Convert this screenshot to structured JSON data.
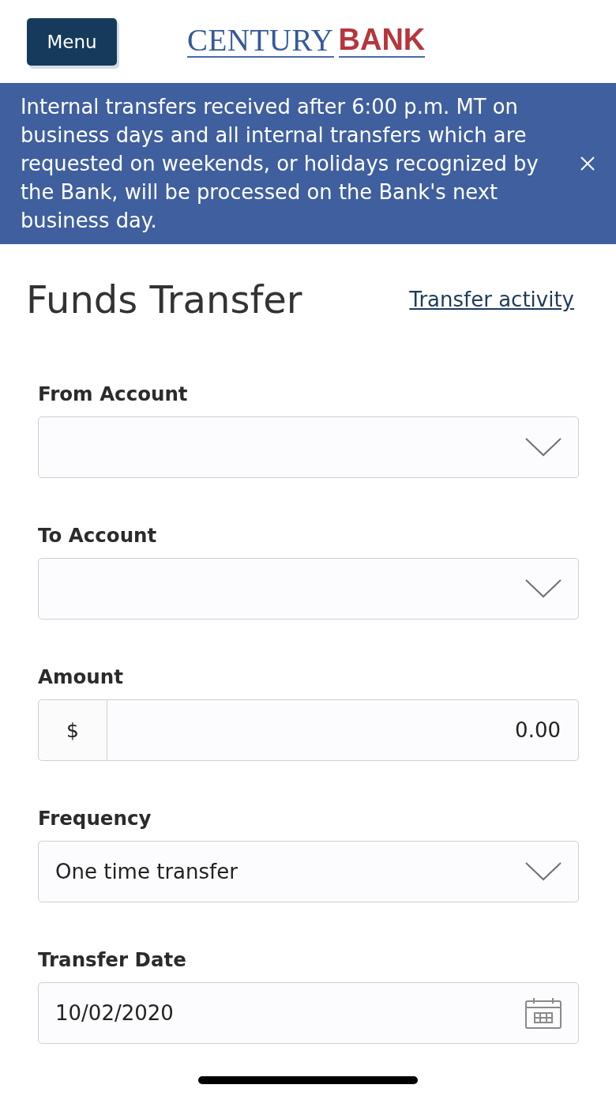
{
  "header": {
    "menu_button": "Menu",
    "logo": [
      "CENTURY",
      "BANK"
    ]
  },
  "notice": {
    "text": "Internal transfers received after 6:00 p.m. MT on business days and all internal transfers which are requested on weekends, or holidays recognized by the Bank, will be processed on the Bank's next business day."
  },
  "page": {
    "title": "Funds Transfer",
    "link": "Transfer activity"
  },
  "fields": [
    {
      "kind": "select",
      "label": "From Account"
    },
    {
      "kind": "select",
      "label": "To Account"
    },
    {
      "kind": "amount",
      "label": "Amount",
      "prefix": "$",
      "value": "0.00"
    },
    {
      "kind": "select",
      "label": "Frequency",
      "value": "One time transfer"
    },
    {
      "kind": "date",
      "label": "Transfer Date",
      "value": "10/02/2020"
    }
  ]
}
